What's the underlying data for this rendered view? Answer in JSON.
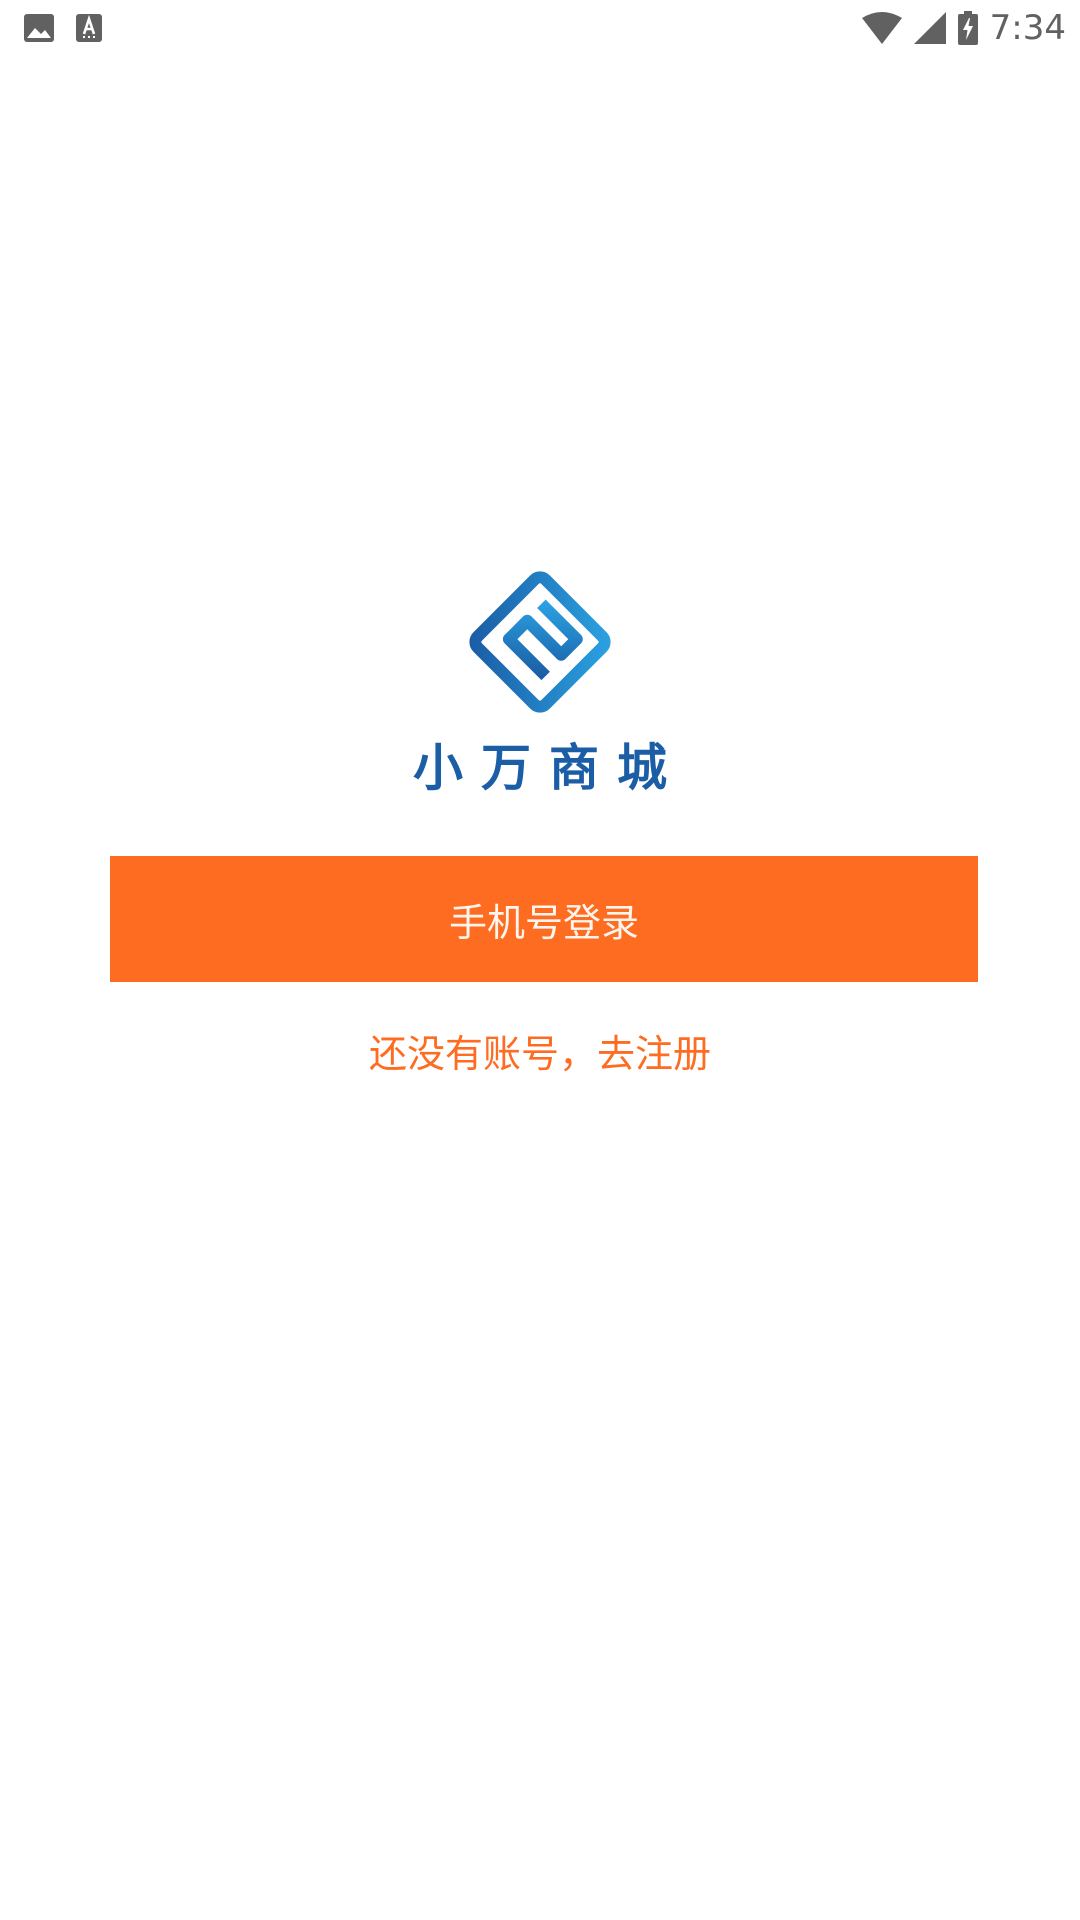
{
  "status_bar": {
    "time": "7:34",
    "left_icons": [
      "image-icon",
      "font-download-icon"
    ],
    "right_icons": [
      "wifi-icon",
      "cellular-signal-icon",
      "battery-charging-icon"
    ],
    "icon_color": "#616161"
  },
  "logo": {
    "icon": "app-logo-icon",
    "text": "小万商城",
    "colors": {
      "dark_blue": "#1b5ea6",
      "light_blue": "#2aa0e0"
    }
  },
  "actions": {
    "login_label": "手机号登录",
    "register_label": "还没有账号，去注册"
  },
  "theme": {
    "accent": "#fe6c22",
    "background": "#ffffff"
  }
}
